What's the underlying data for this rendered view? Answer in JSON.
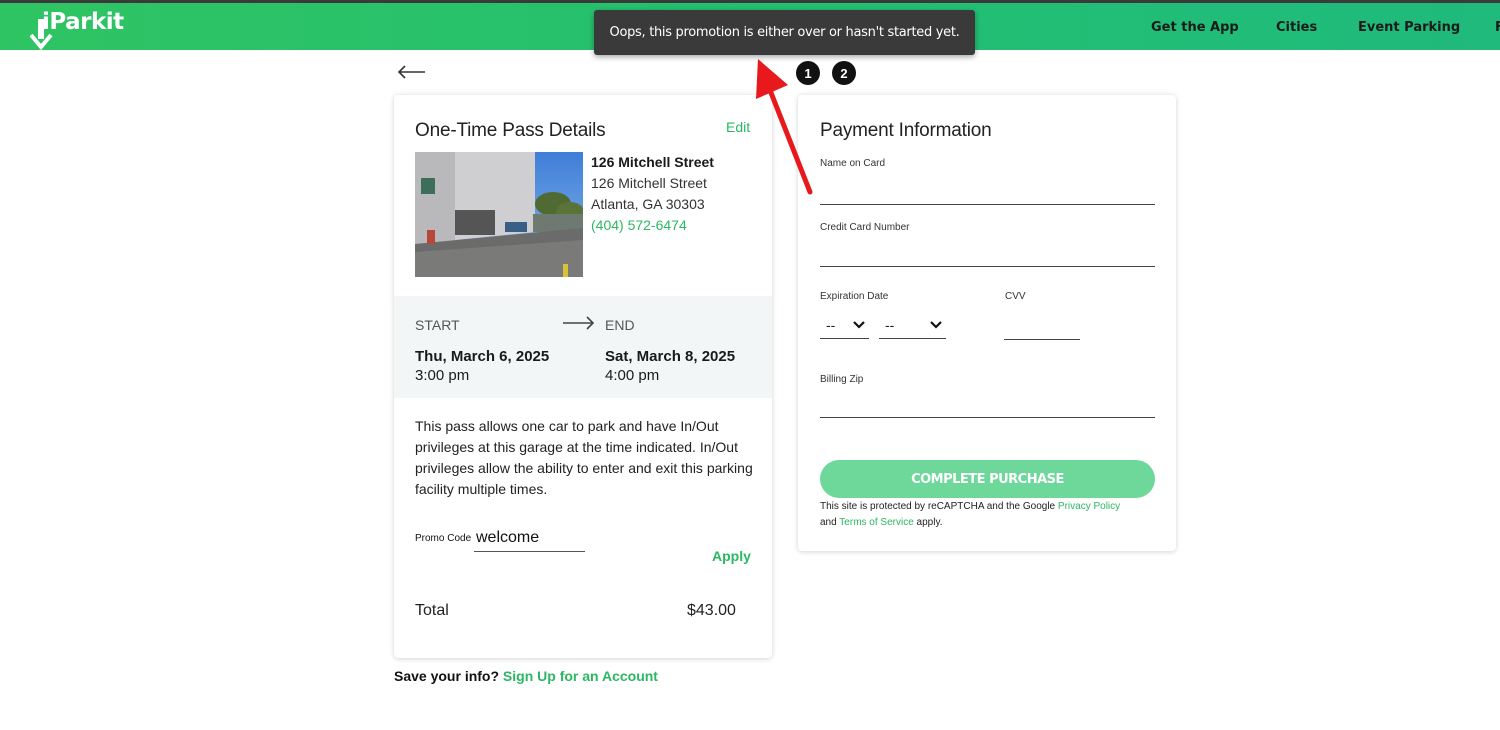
{
  "header": {
    "logo_text": "iParkit",
    "nav": [
      "Get the App",
      "Cities",
      "Event Parking",
      "F"
    ]
  },
  "toast": {
    "message": "Oops, this promotion is either over or hasn't started yet."
  },
  "steps": [
    "1",
    "2"
  ],
  "pass": {
    "title": "One-Time Pass Details",
    "edit_label": "Edit",
    "location_name": "126 Mitchell Street",
    "address_line1": "126 Mitchell Street",
    "address_line2": "Atlanta, GA 30303",
    "phone": "(404) 572-6474",
    "start_label": "START",
    "end_label": "END",
    "start_date": "Thu, March 6, 2025",
    "start_time": "3:00 pm",
    "end_date": "Sat, March 8, 2025",
    "end_time": "4:00 pm",
    "description": "This pass allows one car to park and have In/Out privileges at this garage at the time indicated. In/Out privileges allow the ability to enter and exit this parking facility multiple times.",
    "promo_label": "Promo Code",
    "promo_value": "welcome",
    "apply_label": "Apply",
    "total_label": "Total",
    "total_value": "$43.00"
  },
  "save_info": {
    "prompt": "Save your info?",
    "link": "Sign Up for an Account"
  },
  "payment": {
    "title": "Payment Information",
    "name_label": "Name on Card",
    "card_label": "Credit Card Number",
    "exp_label": "Expiration Date",
    "cvv_label": "CVV",
    "exp_month": "--",
    "exp_year": "--",
    "zip_label": "Billing Zip",
    "purchase_label": "COMPLETE PURCHASE",
    "recaptcha_prefix": "This site is protected by reCAPTCHA and the Google",
    "privacy_link": "Privacy Policy",
    "and_word": "and",
    "terms_link": "Terms of Service",
    "apply_word": "apply."
  },
  "colors": {
    "brand_green": "#2bb863",
    "button_green": "#6dd89a",
    "toast_bg": "#3a3a3a",
    "annotation_red": "#e8191d"
  }
}
